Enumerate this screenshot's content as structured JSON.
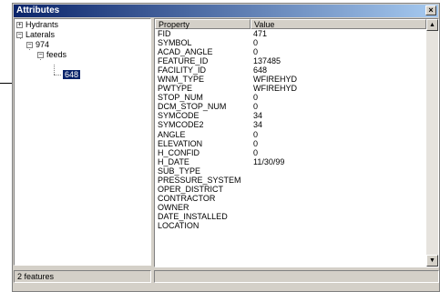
{
  "window": {
    "title": "Attributes",
    "close_label": "×"
  },
  "tree": {
    "items": [
      {
        "label": "Hydrants",
        "toggle": "+"
      },
      {
        "label": "Laterals",
        "toggle": "−"
      },
      {
        "label": "974",
        "toggle": "−"
      },
      {
        "label": "feeds",
        "toggle": "−"
      },
      {
        "label": "648",
        "toggle": ""
      }
    ]
  },
  "grid": {
    "headers": [
      "Property",
      "Value"
    ],
    "rows": [
      {
        "property": "FID",
        "value": "471"
      },
      {
        "property": "SYMBOL",
        "value": "0"
      },
      {
        "property": "ACAD_ANGLE",
        "value": "0"
      },
      {
        "property": "FEATURE_ID",
        "value": "137485"
      },
      {
        "property": "FACILITY_ID",
        "value": "648"
      },
      {
        "property": "WNM_TYPE",
        "value": "WFIREHYD"
      },
      {
        "property": "PWTYPE",
        "value": "WFIREHYD"
      },
      {
        "property": "STOP_NUM",
        "value": "0"
      },
      {
        "property": "DCM_STOP_NUM",
        "value": "0"
      },
      {
        "property": "SYMCODE",
        "value": "34"
      },
      {
        "property": "SYMCODE2",
        "value": "34"
      },
      {
        "property": "ANGLE",
        "value": "0"
      },
      {
        "property": "ELEVATION",
        "value": "0"
      },
      {
        "property": "H_CONFID",
        "value": "0"
      },
      {
        "property": "H_DATE",
        "value": "11/30/99"
      },
      {
        "property": "SUB_TYPE",
        "value": ""
      },
      {
        "property": "PRESSURE_SYSTEM",
        "value": ""
      },
      {
        "property": "OPER_DISTRICT",
        "value": ""
      },
      {
        "property": "CONTRACTOR",
        "value": ""
      },
      {
        "property": "OWNER",
        "value": ""
      },
      {
        "property": "DATE_INSTALLED",
        "value": ""
      },
      {
        "property": "LOCATION",
        "value": ""
      }
    ]
  },
  "scrollbar": {
    "up_icon": "▲",
    "down_icon": "▼"
  },
  "status": {
    "text": "2 features"
  },
  "colors": {
    "title_start": "#0a246a",
    "title_end": "#a6caf0",
    "selection": "#0a246a",
    "face": "#d4d0c8"
  }
}
